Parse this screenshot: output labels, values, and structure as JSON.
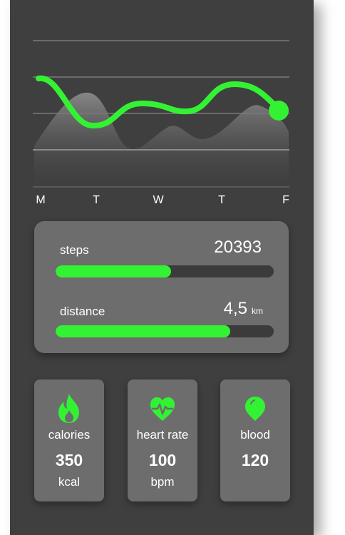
{
  "chart": {
    "days": [
      "M",
      "T",
      "W",
      "T",
      "F"
    ],
    "accent": "#33f233"
  },
  "progress": {
    "steps": {
      "label": "steps",
      "value": "20393",
      "fill": 0.53
    },
    "distance": {
      "label": "distance",
      "value": "4,5",
      "unit": "km",
      "fill": 0.8
    }
  },
  "tiles": [
    {
      "icon": "flame-icon",
      "label": "calories",
      "value": "350",
      "unit": "kcal"
    },
    {
      "icon": "heart-pulse-icon",
      "label": "heart rate",
      "value": "100",
      "unit": "bpm"
    },
    {
      "icon": "blood-drop-icon",
      "label": "blood",
      "value": "120",
      "unit": ""
    }
  ],
  "colors": {
    "background": "#3f3f3f",
    "card": "#6d6d6d",
    "track": "#3b3b3b",
    "accent": "#33f233"
  }
}
